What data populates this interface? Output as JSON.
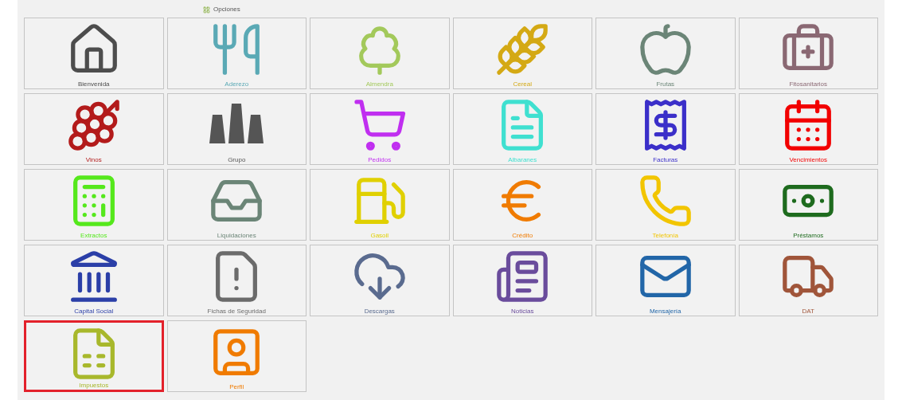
{
  "header": {
    "title": "Opciones"
  },
  "tiles": [
    {
      "label": "Bienvenida",
      "kind": "home",
      "selected": false
    },
    {
      "label": "Aderezo",
      "kind": "olive",
      "selected": false
    },
    {
      "label": "Almendra",
      "kind": "tree",
      "selected": false
    },
    {
      "label": "Cereal",
      "kind": "wheat",
      "selected": false
    },
    {
      "label": "Frutas",
      "kind": "fruit",
      "selected": false
    },
    {
      "label": "Fitosanitarios",
      "kind": "medkit",
      "selected": false
    },
    {
      "label": "Vinos",
      "kind": "grape",
      "selected": false
    },
    {
      "label": "Grupo",
      "kind": "group",
      "selected": false
    },
    {
      "label": "Pedidos",
      "kind": "cart",
      "selected": false
    },
    {
      "label": "Albaranes",
      "kind": "doc",
      "selected": false
    },
    {
      "label": "Facturas",
      "kind": "invoice",
      "selected": false
    },
    {
      "label": "Vencimientos",
      "kind": "calendar",
      "selected": false
    },
    {
      "label": "Extractos",
      "kind": "calculator",
      "selected": false
    },
    {
      "label": "Liquidaciones",
      "kind": "inbox",
      "selected": false
    },
    {
      "label": "Gasoil",
      "kind": "fuel",
      "selected": false
    },
    {
      "label": "Crédito",
      "kind": "euro",
      "selected": false
    },
    {
      "label": "Telefonía",
      "kind": "phone",
      "selected": false
    },
    {
      "label": "Préstamos",
      "kind": "money",
      "selected": false
    },
    {
      "label": "Capital Social",
      "kind": "bank",
      "selected": false
    },
    {
      "label": "Fichas de Seguridad",
      "kind": "warning",
      "selected": false
    },
    {
      "label": "Descargas",
      "kind": "download",
      "selected": false
    },
    {
      "label": "Noticias",
      "kind": "news",
      "selected": false
    },
    {
      "label": "Mensajería",
      "kind": "mail",
      "selected": false
    },
    {
      "label": "DAT",
      "kind": "truck",
      "selected": false
    },
    {
      "label": "Impuestos",
      "kind": "tax",
      "selected": true
    },
    {
      "label": "Perfil",
      "kind": "profile",
      "selected": false
    }
  ]
}
